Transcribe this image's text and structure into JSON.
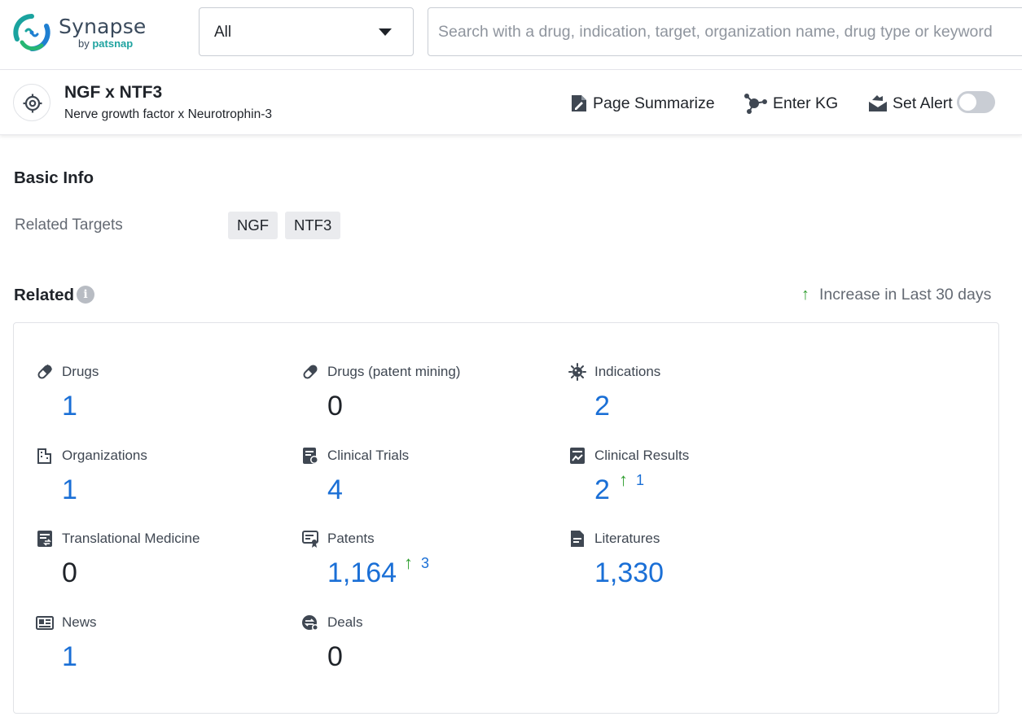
{
  "brand": {
    "name": "Synapse",
    "by": "by",
    "company": "patsnap",
    "colors": {
      "accent": "#1fa3a0",
      "link": "#1a6fd6",
      "increase": "#2e9e2e"
    }
  },
  "header": {
    "scope_value": "All",
    "search_placeholder": "Search with a drug, indication, target, organization name, drug type or keyword"
  },
  "entity": {
    "title": "NGF x NTF3",
    "subtitle": "Nerve growth factor x Neurotrophin-3",
    "actions": {
      "summarize": "Page Summarize",
      "enter_kg": "Enter KG",
      "set_alert": "Set Alert"
    },
    "alert_enabled": false
  },
  "basic_info": {
    "title": "Basic Info",
    "related_targets_label": "Related Targets",
    "targets": [
      "NGF",
      "NTF3"
    ]
  },
  "related": {
    "title": "Related",
    "info_icon": "i",
    "legend_arrow": "↑",
    "legend": "Increase in Last 30 days",
    "items": [
      {
        "icon": "pill-icon",
        "label": "Drugs",
        "value": "1"
      },
      {
        "icon": "pill-icon",
        "label": "Drugs (patent mining)",
        "value": "0"
      },
      {
        "icon": "virus-icon",
        "label": "Indications",
        "value": "2"
      },
      {
        "icon": "building-icon",
        "label": "Organizations",
        "value": "1"
      },
      {
        "icon": "clinical-trials-icon",
        "label": "Clinical Trials",
        "value": "4"
      },
      {
        "icon": "clinical-results-icon",
        "label": "Clinical Results",
        "value": "2",
        "increase": "1"
      },
      {
        "icon": "translational-icon",
        "label": "Translational Medicine",
        "value": "0"
      },
      {
        "icon": "patent-icon",
        "label": "Patents",
        "value": "1,164",
        "increase": "3"
      },
      {
        "icon": "literature-icon",
        "label": "Literatures",
        "value": "1,330"
      },
      {
        "icon": "news-icon",
        "label": "News",
        "value": "1"
      },
      {
        "icon": "deals-icon",
        "label": "Deals",
        "value": "0"
      }
    ]
  }
}
